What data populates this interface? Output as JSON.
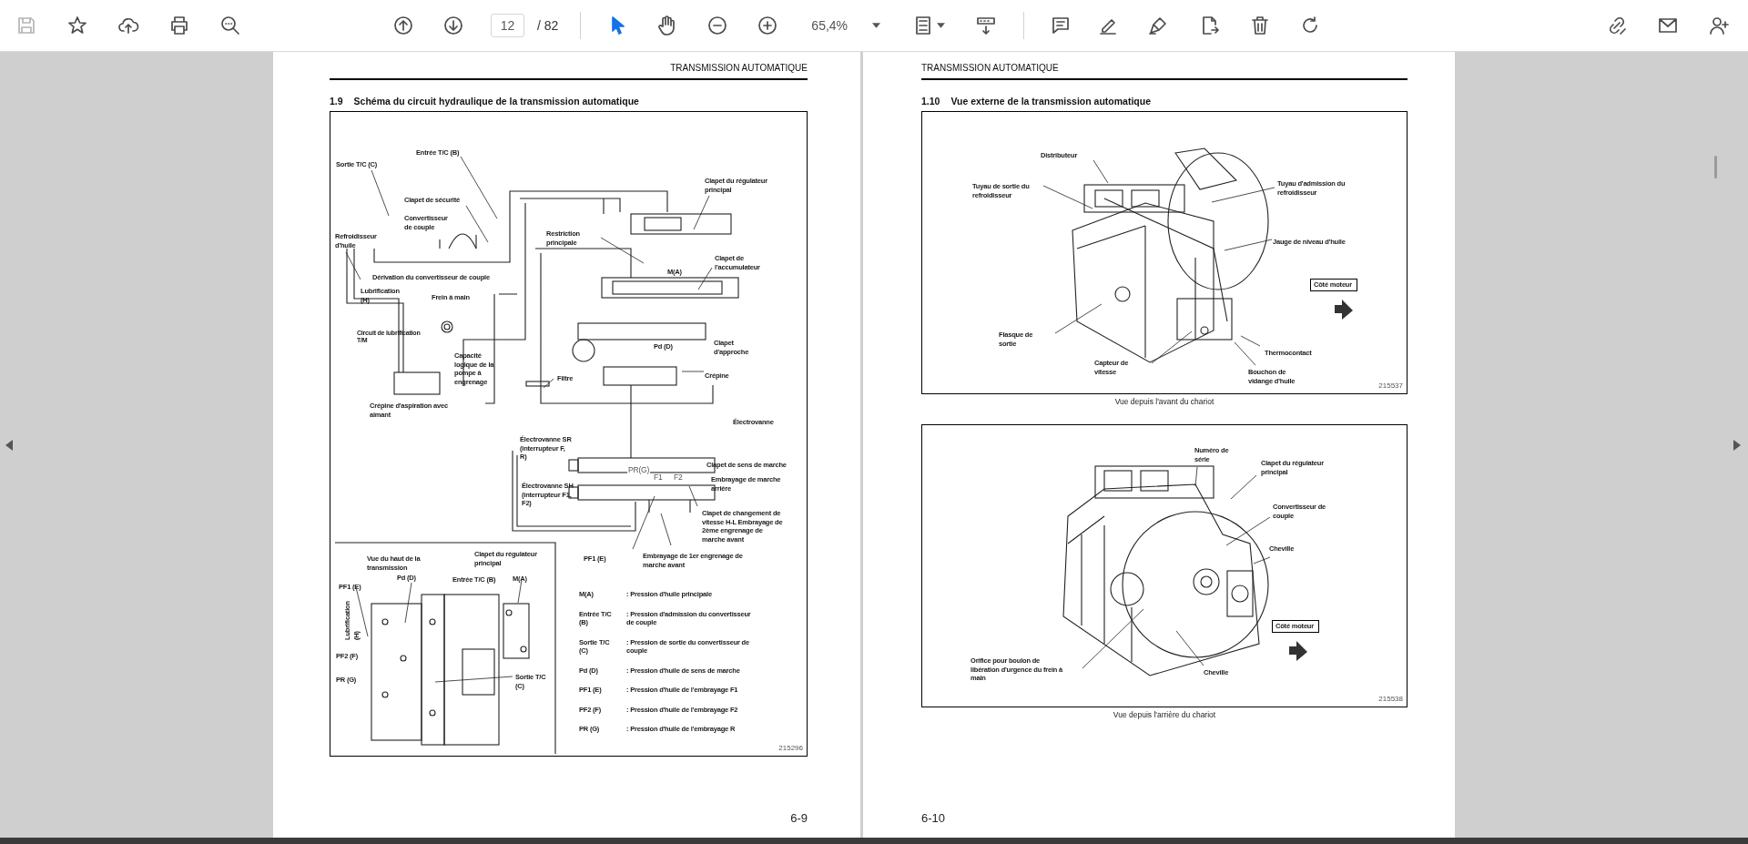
{
  "toolbar": {
    "save_button": {
      "disabled": true
    },
    "page_field": {
      "value": "12"
    },
    "page_count": "/ 82",
    "tools": [
      {
        "kind": "select",
        "selected": true
      },
      {
        "kind": "hand",
        "selected": false
      }
    ],
    "zoom_field": {
      "value": "65,4%"
    }
  },
  "pages": [
    {
      "header": "TRANSMISSION AUTOMATIQUE",
      "section_number": "1.9",
      "section_title": "Schéma du circuit hydraulique de la transmission automatique",
      "figures": [
        {
          "labels": [
            {
              "text": "Sortie T/C (C)",
              "kind": "label"
            },
            {
              "text": "Entrée T/C (B)",
              "kind": "label"
            },
            {
              "text": "Clapet de sécurité",
              "kind": "label"
            },
            {
              "text": "Convertisseur\nde couple",
              "kind": "label"
            },
            {
              "text": "Refroidisseur\nd'huile",
              "kind": "label"
            },
            {
              "text": "Dérivation du convertisseur de couple",
              "kind": "label"
            },
            {
              "text": "Lubrification\n(H)",
              "kind": "label"
            },
            {
              "text": "Frein à main",
              "kind": "label"
            },
            {
              "text": "Circuit de lubrification\nT/M",
              "kind": "small"
            },
            {
              "text": "Capacité\nlogique de la\npompe à\nengrenage",
              "kind": "label"
            },
            {
              "text": "Crépine d'aspiration avec\naimant",
              "kind": "label"
            },
            {
              "text": "Clapet du régulateur\nprincipal",
              "kind": "label"
            },
            {
              "text": "Restriction\nprincipale",
              "kind": "label"
            },
            {
              "text": "M(A)",
              "kind": "label"
            },
            {
              "text": "Clapet de\nl'accumulateur",
              "kind": "label"
            },
            {
              "text": "Pd (D)",
              "kind": "label"
            },
            {
              "text": "Clapet\nd'approche",
              "kind": "label"
            },
            {
              "text": "Crépine",
              "kind": "label"
            },
            {
              "text": "Filtre",
              "kind": "label"
            },
            {
              "text": "Électrovanne",
              "kind": "label"
            },
            {
              "text": "Électrovanne SR\n(interrupteur F,\nR)",
              "kind": "label"
            },
            {
              "text": "PR(G)",
              "kind": "grey"
            },
            {
              "text": "F1",
              "kind": "grey"
            },
            {
              "text": "F2",
              "kind": "grey"
            },
            {
              "text": "Clapet de sens de marche",
              "kind": "label"
            },
            {
              "text": "Embrayage de marche\narrière",
              "kind": "label"
            },
            {
              "text": "Électrovanne SH\n(interrupteur F1,\nF2)",
              "kind": "label"
            },
            {
              "text": "Clapet de changement de\nvitesse H-L Embrayage de\n2ème engrenage de\nmarche avant",
              "kind": "label"
            },
            {
              "text": "Vue du haut de la\ntransmission",
              "kind": "label"
            },
            {
              "text": "Clapet du régulateur\nprincipal",
              "kind": "label"
            },
            {
              "text": "PF1 (E)",
              "kind": "label"
            },
            {
              "text": "Embrayage de 1er engrenage de\nmarche avant",
              "kind": "label"
            },
            {
              "text": "Pd (D)",
              "kind": "label"
            },
            {
              "text": "Entrée T/C (B)",
              "kind": "label"
            },
            {
              "text": "M(A)",
              "kind": "label"
            },
            {
              "text": "PF1 (E)",
              "kind": "label"
            },
            {
              "text": "Lubrification\n(H)",
              "kind": "vertical"
            },
            {
              "text": "PF2 (F)",
              "kind": "label"
            },
            {
              "text": "PR (G)",
              "kind": "label"
            },
            {
              "text": "Sortie T/C\n(C)",
              "kind": "label"
            }
          ],
          "legend": [
            {
              "key": "M(A)",
              "value": ": Pression d'huile principale"
            },
            {
              "key": "Entrée T/C\n(B)",
              "value": ": Pression d'admission du convertisseur\nde couple"
            },
            {
              "key": "Sortie T/C\n(C)",
              "value": ": Pression de sortie du convertisseur de\ncouple"
            },
            {
              "key": "Pd (D)",
              "value": ": Pression d'huile de sens de marche"
            },
            {
              "key": "PF1 (E)",
              "value": ": Pression d'huile de l'embrayage F1"
            },
            {
              "key": "PF2 (F)",
              "value": ": Pression d'huile de l'embrayage F2"
            },
            {
              "key": "PR (G)",
              "value": ": Pression d'huile de l'embrayage R"
            }
          ],
          "figure_number": "215296"
        }
      ],
      "page_number": "6-9"
    },
    {
      "header": "TRANSMISSION AUTOMATIQUE",
      "section_number": "1.10",
      "section_title": "Vue externe de la transmission automatique",
      "figures": [
        {
          "labels": [
            {
              "text": "Distributeur",
              "kind": "label"
            },
            {
              "text": "Tuyau de sortie du\nrefroidisseur",
              "kind": "label"
            },
            {
              "text": "Tuyau d'admission du\nrefroidisseur",
              "kind": "label"
            },
            {
              "text": "Jauge de niveau d'huile",
              "kind": "label"
            },
            {
              "text": "Côté moteur",
              "kind": "boxed"
            },
            {
              "text": "Flasque de\nsortie",
              "kind": "label"
            },
            {
              "text": "Capteur de\nvitesse",
              "kind": "label"
            },
            {
              "text": "Thermocontact",
              "kind": "label"
            },
            {
              "text": "Bouchon de\nvidange d'huile",
              "kind": "label"
            }
          ],
          "figure_number": "215537",
          "caption": "Vue depuis l'avant du chariot"
        },
        {
          "labels": [
            {
              "text": "Numéro de\nsérie",
              "kind": "label"
            },
            {
              "text": "Clapet du régulateur\nprincipal",
              "kind": "label"
            },
            {
              "text": "Convertisseur de\ncouple",
              "kind": "label"
            },
            {
              "text": "Cheville",
              "kind": "label"
            },
            {
              "text": "Côté moteur",
              "kind": "boxed"
            },
            {
              "text": "Orifice pour boulon de\nlibération d'urgence du frein à\nmain",
              "kind": "label"
            },
            {
              "text": "Cheville",
              "kind": "label"
            }
          ],
          "figure_number": "215538",
          "caption": "Vue depuis l'arrière du chariot"
        }
      ],
      "page_number": "6-10"
    }
  ]
}
